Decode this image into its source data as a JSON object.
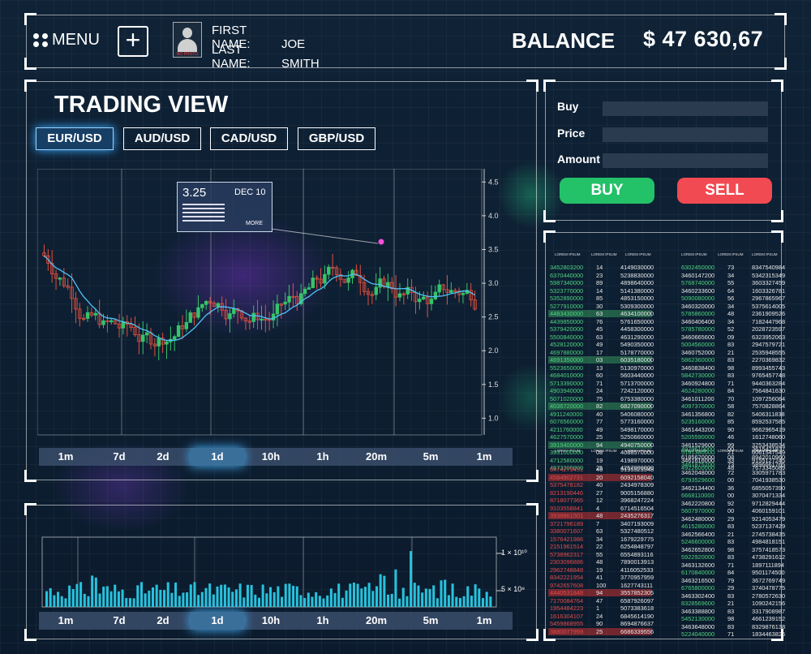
{
  "header": {
    "menu_label": "MENU",
    "first_name_label": "FIRST NAME:",
    "first_name": "JOE",
    "last_name_label": "LAST NAME:",
    "last_name": "SMITH",
    "avatar_caption": "NO PHOTO",
    "balance_label": "BALANCE",
    "balance_value": "$ 47  630,67"
  },
  "trading": {
    "title": "TRADING  VIEW",
    "pairs": [
      "EUR/USD",
      "AUD/USD",
      "CAD/USD",
      "GBP/USD"
    ],
    "active_pair": "EUR/USD",
    "tooltip": {
      "value": "3.25",
      "date": "DEC 10",
      "more": "MORE"
    },
    "timeframes": [
      "1m",
      "7d",
      "2d",
      "1d",
      "10h",
      "1h",
      "20m",
      "5m",
      "1m"
    ],
    "active_timeframe": "1d"
  },
  "volume": {
    "timeframes": [
      "1m",
      "7d",
      "2d",
      "1d",
      "10h",
      "1h",
      "20m",
      "5m",
      "1m"
    ],
    "active_timeframe": "1d",
    "y_ticks": [
      "1 × 10¹⁰",
      "5 × 10⁹"
    ]
  },
  "chart_data": {
    "type": "candlestick",
    "title": "",
    "y_ticks": [
      "4.5",
      "4.0",
      "3.5",
      "3.0",
      "2.5",
      "2.0",
      "1.5",
      "1.0"
    ],
    "ylim": [
      0.8,
      4.6
    ]
  },
  "order": {
    "buy_label": "Buy",
    "price_label": "Price",
    "amount_label": "Amount",
    "buy_button": "BUY",
    "sell_button": "SELL"
  },
  "orderbook": {
    "header_cols": [
      "LOREM IPSUM",
      "LOREM IPSUM",
      "LOREM IPSUM"
    ],
    "top_left": [
      [
        "3452803200",
        "14",
        "4149030000"
      ],
      [
        "6370440000",
        "23",
        "5238830000"
      ],
      [
        "5987340000",
        "89",
        "4898640000"
      ],
      [
        "5323770000",
        "14",
        "5141380000"
      ],
      [
        "5352890000",
        "85",
        "4853150000"
      ],
      [
        "5277910000",
        "30",
        "5309300000"
      ],
      [
        "4483430000",
        "63",
        "4634100000"
      ],
      [
        "4439850000",
        "76",
        "5761650000"
      ],
      [
        "5379420000",
        "45",
        "4458300000"
      ],
      [
        "5500840000",
        "63",
        "4631290000"
      ],
      [
        "4528120000",
        "49",
        "5490350000"
      ],
      [
        "4697880000",
        "17",
        "5178770000"
      ],
      [
        "4691350000",
        "03",
        "6035180000"
      ],
      [
        "5523650000",
        "13",
        "5130970000"
      ],
      [
        "4684010000",
        "60",
        "5603440000"
      ],
      [
        "5713390000",
        "71",
        "5713700000"
      ],
      [
        "4903940000",
        "24",
        "7242120000"
      ],
      [
        "5071020000",
        "75",
        "6753380000"
      ],
      [
        "4036720000",
        "82",
        "6827090000"
      ],
      [
        "4911240000",
        "40",
        "5406080000"
      ],
      [
        "6076560000",
        "77",
        "5773160000"
      ],
      [
        "4211760000",
        "49",
        "5498170000"
      ],
      [
        "4627570000",
        "25",
        "5250660000"
      ],
      [
        "3919400000",
        "94",
        "4940750000"
      ],
      [
        "3931000000",
        "08",
        "4088570000"
      ],
      [
        "4712580000",
        "19",
        "4198970000"
      ],
      [
        "4673300000",
        "25",
        "4257000000"
      ]
    ],
    "top_right": [
      [
        "6302450000",
        "73",
        "8347540984"
      ],
      [
        "3460147200",
        "34",
        "5342315349"
      ],
      [
        "5768740000",
        "55",
        "3603327459"
      ],
      [
        "3460233600",
        "64",
        "1603326781"
      ],
      [
        "5090080000",
        "56",
        "2967865967"
      ],
      [
        "3460320000",
        "34",
        "5375614005"
      ],
      [
        "5785860000",
        "48",
        "2361909526"
      ],
      [
        "3460406400",
        "34",
        "7182447968"
      ],
      [
        "5785780000",
        "52",
        "2028723597"
      ],
      [
        "3460665600",
        "09",
        "6323952063"
      ],
      [
        "5004560000",
        "83",
        "2947579721"
      ],
      [
        "3460752000",
        "21",
        "2535948555"
      ],
      [
        "5862360000",
        "83",
        "2270369832"
      ],
      [
        "3460838400",
        "98",
        "8993455743"
      ],
      [
        "5842730000",
        "83",
        "9765457748"
      ],
      [
        "3460924800",
        "71",
        "9440363284"
      ],
      [
        "4624280000",
        "84",
        "7564841630"
      ],
      [
        "3461011200",
        "70",
        "1097256084"
      ],
      [
        "4097370000",
        "58",
        "7570828864"
      ],
      [
        "3461356800",
        "82",
        "5406311838"
      ],
      [
        "5235160000",
        "85",
        "8592537585"
      ],
      [
        "3461443200",
        "90",
        "9662965419"
      ],
      [
        "5205590000",
        "46",
        "1612748060"
      ],
      [
        "3461529600",
        "99",
        "3253438534"
      ],
      [
        "5191380000",
        "21",
        "6061547549"
      ],
      [
        "3461616000",
        "33",
        "9155127245"
      ],
      [
        "4922600000",
        "48",
        "7673345089"
      ]
    ],
    "bottom_left": [
      [
        "6474279451",
        "46",
        "9195523948"
      ],
      [
        "4584902731",
        "20",
        "6092158040"
      ],
      [
        "5375478182",
        "40",
        "2434978309"
      ],
      [
        "8213190446",
        "27",
        "9005156880"
      ],
      [
        "8718077365",
        "12",
        "3968247224"
      ],
      [
        "9103558841",
        "4",
        "6714516504"
      ],
      [
        "3938861501",
        "48",
        "2435276317"
      ],
      [
        "3721796189",
        "7",
        "3407193009"
      ],
      [
        "3380071607",
        "63",
        "5327480512"
      ],
      [
        "1576421986",
        "34",
        "1679229775"
      ],
      [
        "2151961514",
        "22",
        "6254848797"
      ],
      [
        "5738962317",
        "55",
        "6554893116"
      ],
      [
        "2303096886",
        "48",
        "7890013913"
      ],
      [
        "2962748848",
        "19",
        "4116052533"
      ],
      [
        "8342221954",
        "41",
        "3770957959"
      ],
      [
        "9742657608",
        "100",
        "1627743111"
      ],
      [
        "4440531848",
        "94",
        "3557852305"
      ],
      [
        "7170084764",
        "47",
        "6587926097"
      ],
      [
        "1954484223",
        "1",
        "5073383618"
      ],
      [
        "1616304107",
        "24",
        "6845614190"
      ],
      [
        "5459868955",
        "90",
        "8694876637"
      ],
      [
        "3880077959",
        "25",
        "6686339556"
      ]
    ],
    "bottom_right": [
      [
        "4979610000",
        "00",
        "3615421837"
      ],
      [
        "6185620000",
        "08",
        "8942010960"
      ],
      [
        "3461875200",
        "73",
        "5896661765"
      ],
      [
        "3462048000",
        "72",
        "3305971783"
      ],
      [
        "6793529600",
        "00",
        "7041938530"
      ],
      [
        "3462134400",
        "36",
        "6855057390"
      ],
      [
        "6668110000",
        "00",
        "3070471334"
      ],
      [
        "3462220800",
        "92",
        "9712829444"
      ],
      [
        "5607970000",
        "00",
        "4060159101"
      ],
      [
        "3462480000",
        "29",
        "9214053479"
      ],
      [
        "4615280000",
        "83",
        "5237137429"
      ],
      [
        "3462566400",
        "21",
        "2745738435"
      ],
      [
        "5246600000",
        "83",
        "4984818151"
      ],
      [
        "3462652800",
        "98",
        "3757418573"
      ],
      [
        "5922920000",
        "83",
        "4738291612"
      ],
      [
        "3463132600",
        "71",
        "1897111894"
      ],
      [
        "6170840000",
        "84",
        "9501174500"
      ],
      [
        "3463216500",
        "79",
        "3672769749"
      ],
      [
        "6765800000",
        "29",
        "3740478775"
      ],
      [
        "3463302400",
        "83",
        "2780572630"
      ],
      [
        "8328569600",
        "21",
        "1090242156"
      ],
      [
        "3463388800",
        "83",
        "3317908987"
      ],
      [
        "5452130000",
        "98",
        "4661239152"
      ],
      [
        "3463648000",
        "83",
        "8329876138"
      ],
      [
        "5224040000",
        "71",
        "1834463826"
      ]
    ]
  }
}
